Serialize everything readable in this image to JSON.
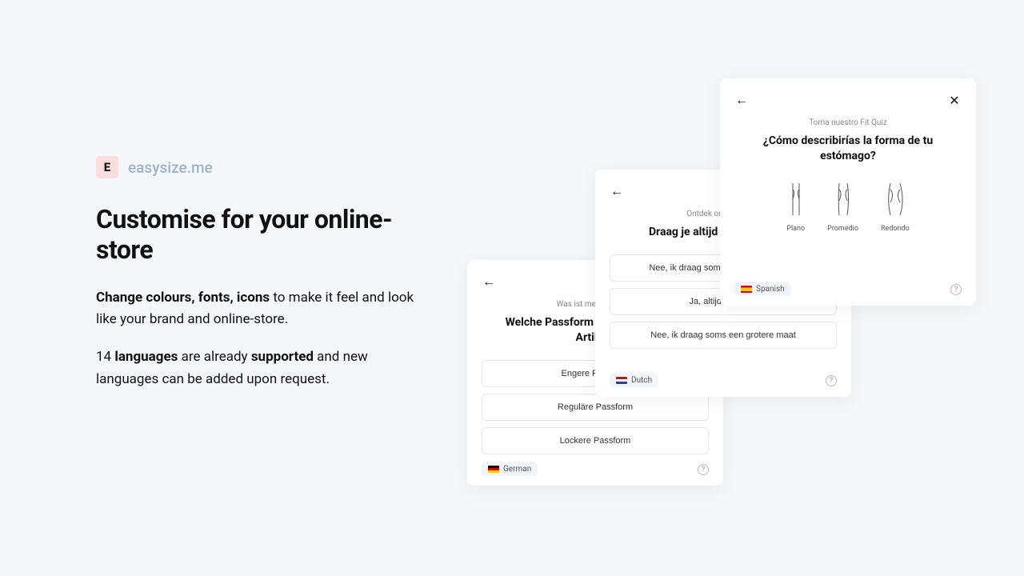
{
  "brand": {
    "mark": "E",
    "name": "easysize.me"
  },
  "heading": "Customise for your online-store",
  "para1_strong": "Change colours, fonts, icons",
  "para1_rest": " to make it feel and look like your brand and online-store.",
  "para2_a": "14 ",
  "para2_b": "languages",
  "para2_c": " are already ",
  "para2_d": "supported",
  "para2_e": " and new languages can be added upon request.",
  "card_back": {
    "subtitle": "Was ist meine Größe?",
    "question": "Welche Passform bevorzugst du für Artikel?",
    "options": [
      "Engere Passform",
      "Reguläre Passform",
      "Lockere Passform"
    ],
    "lang": "German"
  },
  "card_mid": {
    "subtitle": "Ontdek onze Fit Quiz",
    "question": "Draag je altijd dezelfde maat?",
    "options": [
      "Nee, ik draag soms een kleinere maat",
      "Ja, altijd dezelfde",
      "Nee, ik draag soms een grotere maat"
    ],
    "lang": "Dutch"
  },
  "card_front": {
    "subtitle": "Toma nuestro Fit Quiz",
    "question": "¿Cómo describirías la forma de tu estómago?",
    "shapes": [
      "Plano",
      "Promedio",
      "Redondo"
    ],
    "lang": "Spanish"
  }
}
